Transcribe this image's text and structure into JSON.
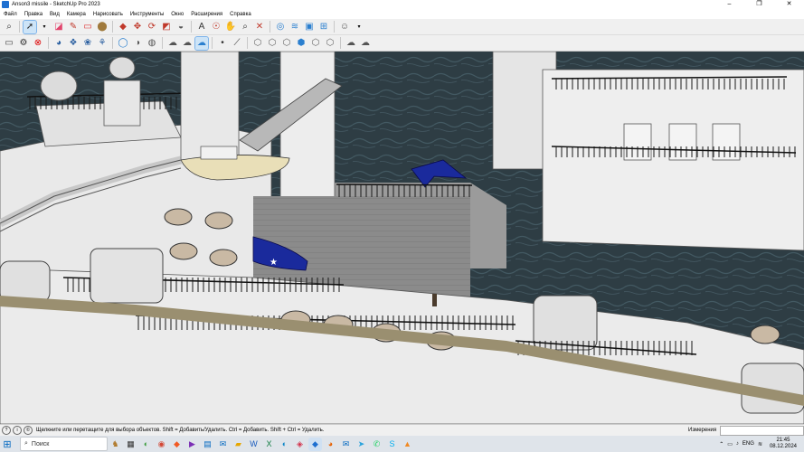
{
  "window": {
    "title": "Anson3 missile - SketchUp Pro 2023",
    "controls": {
      "minimize": "–",
      "maximize": "❐",
      "close": "✕"
    }
  },
  "menu": [
    "Файл",
    "Правка",
    "Вид",
    "Камера",
    "Нарисовать",
    "Инструменты",
    "Окно",
    "Расширения",
    "Справка"
  ],
  "toolbar1": {
    "icons": [
      "search-icon",
      "select-arrow-icon",
      "eraser-icon",
      "pencil-icon",
      "rectangle-icon",
      "paint-bucket-icon",
      "push-pull-icon",
      "move-icon",
      "rotate-icon",
      "scale-icon",
      "tape-measure-icon",
      "text-icon",
      "orbit-icon",
      "pan-icon",
      "zoom-icon",
      "zoom-extents-icon",
      "section-plane-icon",
      "sandbox-icon",
      "warehouse-icon",
      "extension-icon",
      "profile-icon"
    ]
  },
  "toolbar2": {
    "icons": [
      "folder-open-icon",
      "gear-icon",
      "cancel-icon",
      "styles-icon",
      "tag-icon",
      "paint-icon",
      "person-icon",
      "xray-icon",
      "back-edges-icon",
      "wireframe-icon",
      "hidden-line-icon",
      "shaded-icon",
      "textures-icon",
      "monochrome-icon",
      "download-icon",
      "upload-icon",
      "sync-icon",
      "dot-icon",
      "line-icon",
      "view-iso-icon",
      "view-top-icon",
      "view-front-icon",
      "view-right-icon",
      "view-back-icon",
      "view-left-icon",
      "cloud-icon",
      "cloud-upload-icon"
    ]
  },
  "status": {
    "hint": "Щелкните или перетащите для выбора объектов. Shift = Добавить/Удалить. Ctrl = Добавить. Shift + Ctrl = Удалить.",
    "measurement_label": "Измерения",
    "measurement_value": ""
  },
  "taskbar": {
    "search_placeholder": "Поиск",
    "language": "ENG",
    "time": "21:45",
    "date": "08.12.2024",
    "apps": [
      "giraffe-icon",
      "task-view-icon",
      "android-icon",
      "chrome-icon",
      "brave-icon",
      "media-icon",
      "calendar-icon",
      "outlook-icon",
      "folder-icon",
      "word-icon",
      "excel-icon",
      "edge-icon",
      "photos-icon",
      "sketchup-icon",
      "firefox-icon",
      "mail-icon",
      "telegram-icon",
      "whatsapp-icon",
      "skype-icon",
      "vlc-icon"
    ]
  },
  "colors": {
    "sea": "#2e3d44",
    "deck": "#8a8a8a",
    "hull": "#ececec",
    "railing": "#1a1a1a",
    "aircraft_blue": "#1a2a9c",
    "accent": "#0067c0"
  }
}
